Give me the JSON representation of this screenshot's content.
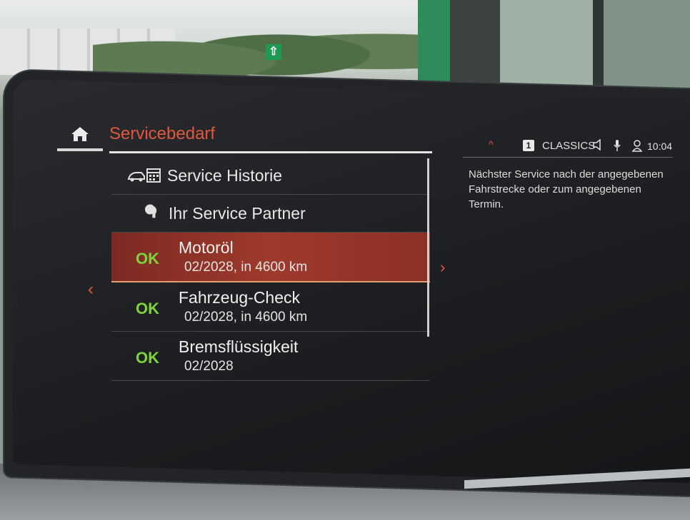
{
  "header": {
    "title": "Servicebedarf"
  },
  "list": {
    "menu_items": [
      {
        "label": "Service Historie",
        "icon": "car-calendar-icon"
      },
      {
        "label": "Ihr Service Partner",
        "icon": "wrench-icon"
      }
    ],
    "services": [
      {
        "status": "OK",
        "name": "Motoröl",
        "due": "02/2028, in 4600 km",
        "selected": true
      },
      {
        "status": "OK",
        "name": "Fahrzeug-Check",
        "due": "02/2028, in 4600 km",
        "selected": false
      },
      {
        "status": "OK",
        "name": "Bremsflüssigkeit",
        "due": "02/2028",
        "selected": false
      }
    ]
  },
  "status_bar": {
    "preset_number": "1",
    "station": "CLASSICS",
    "time": "10:04"
  },
  "info_panel": {
    "text": "Nächster Service nach der angegebenen Fahrstrecke oder zum angegebenen Termin."
  },
  "nav": {
    "left_arrow": "‹",
    "right_arrow": "›",
    "up_arrow": "^"
  },
  "colors": {
    "accent": "#e2583e",
    "ok_green": "#7cd43a",
    "selected_row": "#9e3a2c"
  }
}
